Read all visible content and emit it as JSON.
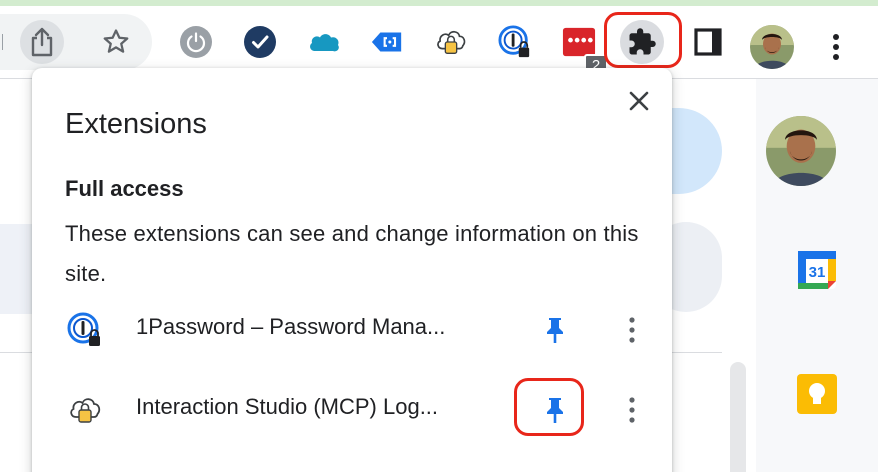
{
  "colors": {
    "accent_blue": "#1a73e8",
    "highlight_red": "#e8261a",
    "toolbar_icon": "#5f6368"
  },
  "toolbar": {
    "share_icon": "share-icon",
    "bookmark_icon": "star-icon",
    "extensions_badge_count": "2",
    "extensions_button_icon": "puzzle-icon",
    "menu_icon": "more-vertical-icon"
  },
  "side_panel": {
    "calendar_label": "31"
  },
  "extensions_popup": {
    "title": "Extensions",
    "section_heading": "Full access",
    "section_description": "These extensions can see and change information on this site.",
    "items": [
      {
        "name": "1Password – Password Mana...",
        "icon": "1password-icon",
        "pinned": true
      },
      {
        "name": "Interaction Studio (MCP) Log...",
        "icon": "cloud-lock-icon",
        "pinned": true
      }
    ]
  }
}
